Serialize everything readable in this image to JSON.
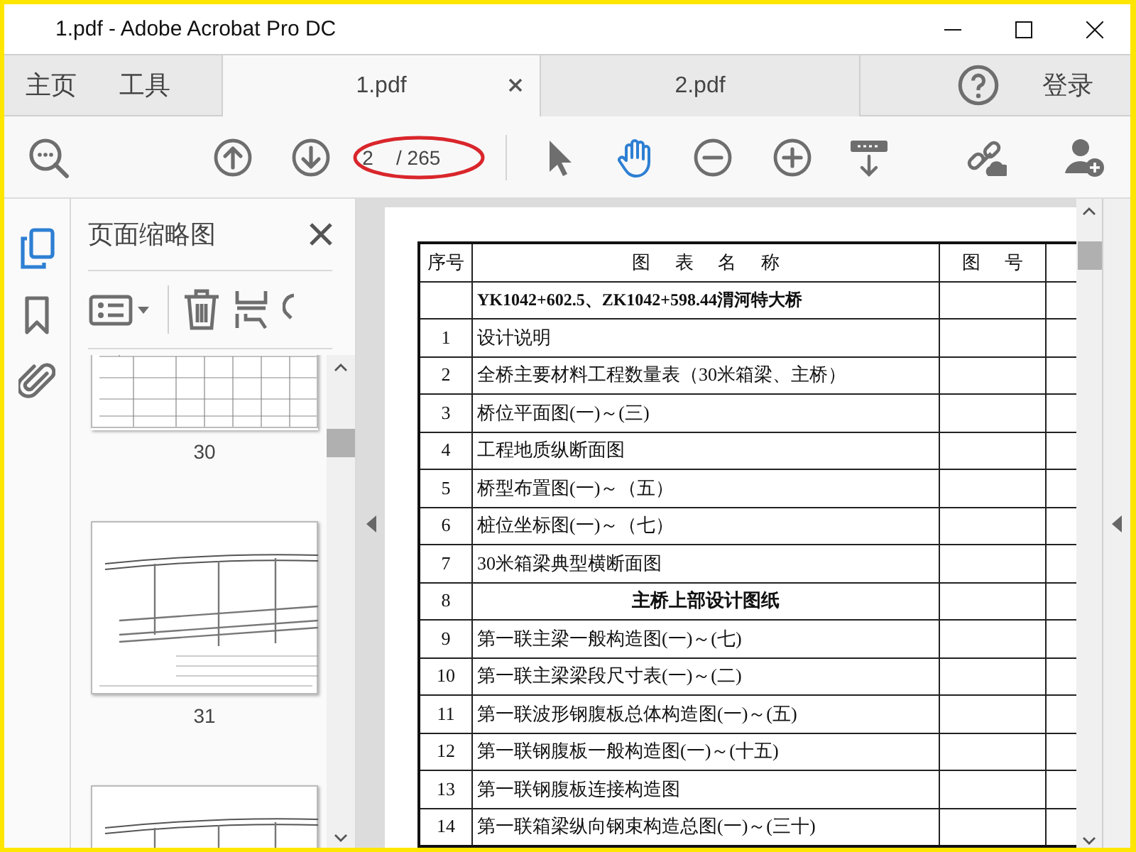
{
  "window": {
    "title": "1.pdf - Adobe Acrobat Pro DC"
  },
  "tabs": [
    {
      "label": "主页",
      "kind": "nav",
      "selected": false
    },
    {
      "label": "工具",
      "kind": "nav",
      "selected": false
    },
    {
      "label": "1.pdf",
      "kind": "document",
      "selected": true
    },
    {
      "label": "2.pdf",
      "kind": "document",
      "selected": false
    }
  ],
  "account": {
    "login": "登录"
  },
  "toolbar": {
    "page_number": "2",
    "page_total": "/ 265",
    "tools": [
      {
        "kind": "select",
        "selected": false
      },
      {
        "kind": "hand",
        "selected": true
      }
    ]
  },
  "side_rail": [
    {
      "kind": "pages",
      "selected": true
    },
    {
      "kind": "bookmarks",
      "selected": false
    },
    {
      "kind": "attachments",
      "selected": false
    }
  ],
  "thumbnail_panel": {
    "title": "页面缩略图",
    "thumbnails": [
      {
        "label": "30",
        "kind": "table"
      },
      {
        "label": "31",
        "kind": "elevation"
      },
      {
        "kind": "elevation"
      }
    ]
  },
  "document": {
    "columns": [
      "序号",
      "图 表 名 称",
      "图 号"
    ],
    "rows": [
      {
        "name": "YK1042+602.5、ZK1042+598.44渭河特大桥",
        "kind": "title"
      },
      {
        "no": "1",
        "name": "设计说明",
        "kind": "item"
      },
      {
        "no": "2",
        "name": "全桥主要材料工程数量表（30米箱梁、主桥）",
        "kind": "item"
      },
      {
        "no": "3",
        "name": "桥位平面图(一)～(三)",
        "kind": "item"
      },
      {
        "no": "4",
        "name": "工程地质纵断面图",
        "kind": "item"
      },
      {
        "no": "5",
        "name": "桥型布置图(一)～（五）",
        "kind": "item"
      },
      {
        "no": "6",
        "name": "桩位坐标图(一)～（七）",
        "kind": "item"
      },
      {
        "no": "7",
        "name": "30米箱梁典型横断面图",
        "kind": "item"
      },
      {
        "no": "8",
        "name": "主桥上部设计图纸",
        "kind": "section"
      },
      {
        "no": "9",
        "name": "第一联主梁一般构造图(一)～(七)",
        "kind": "item"
      },
      {
        "no": "10",
        "name": "第一联主梁梁段尺寸表(一)～(二)",
        "kind": "item"
      },
      {
        "no": "11",
        "name": "第一联波形钢腹板总体构造图(一)～(五)",
        "kind": "item"
      },
      {
        "no": "12",
        "name": "第一联钢腹板一般构造图(一)～(十五)",
        "kind": "item"
      },
      {
        "no": "13",
        "name": "第一联钢腹板连接构造图",
        "kind": "item"
      },
      {
        "no": "14",
        "name": "第一联箱梁纵向钢束构造总图(一)～(三十)",
        "kind": "item"
      }
    ]
  }
}
